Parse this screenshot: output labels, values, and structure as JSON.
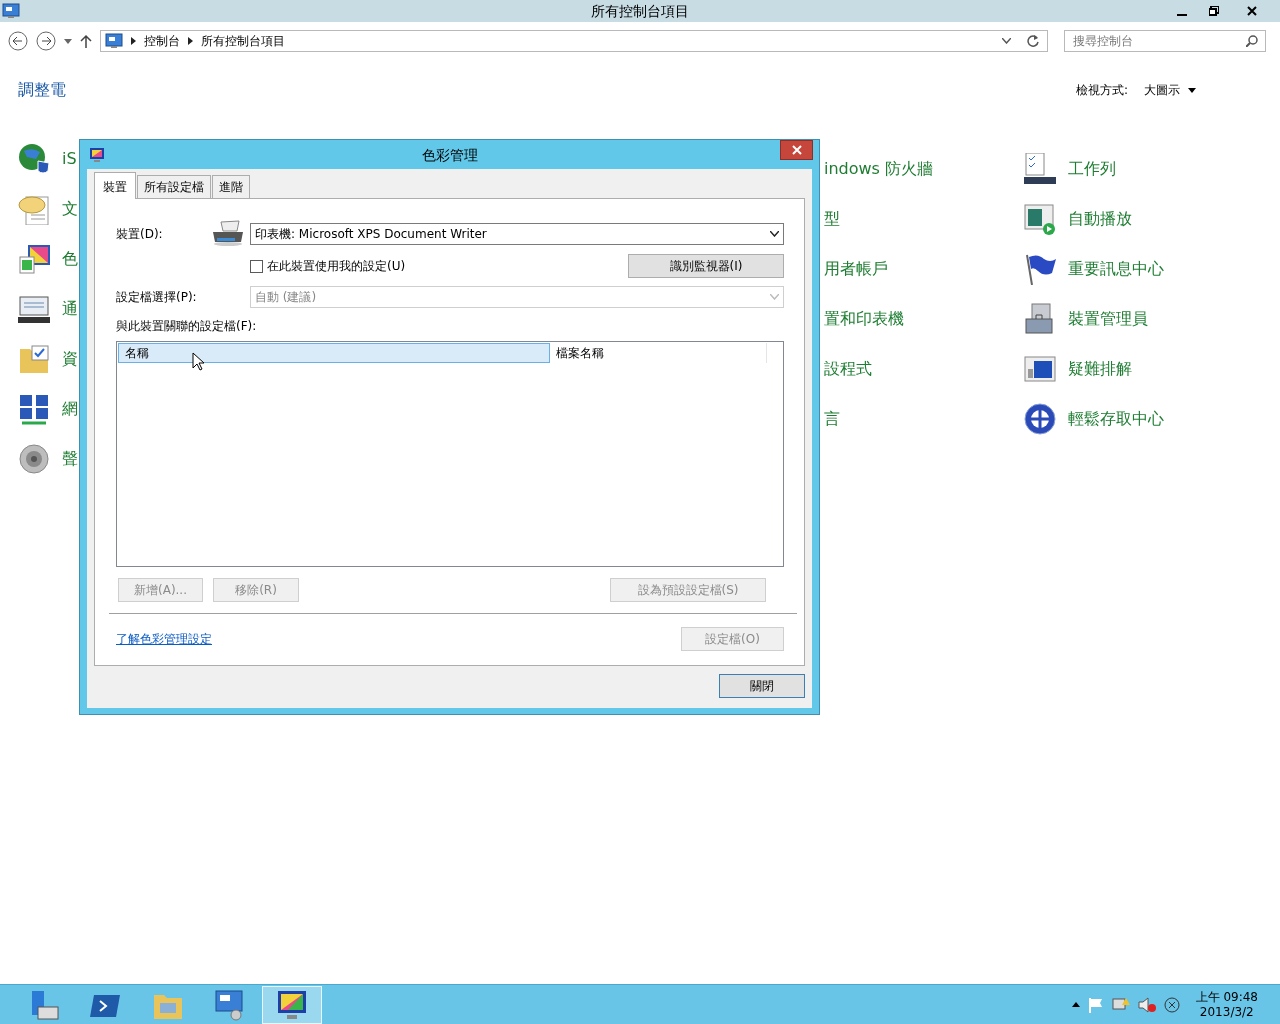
{
  "window": {
    "title": "所有控制台項目"
  },
  "address_bar": {
    "breadcrumbs": [
      "控制台",
      "所有控制台項目"
    ]
  },
  "search": {
    "placeholder": "搜尋控制台"
  },
  "heading": "調整電",
  "view_by": {
    "label": "檢視方式:",
    "value": "大圖示"
  },
  "items_left": [
    {
      "kind": "globe",
      "label": "iS"
    },
    {
      "kind": "speech",
      "label": "文"
    },
    {
      "kind": "color",
      "label": "色"
    },
    {
      "kind": "display",
      "label": "通"
    },
    {
      "kind": "folder",
      "label": "資"
    },
    {
      "kind": "network",
      "label": "網"
    },
    {
      "kind": "speaker",
      "label": "聲"
    }
  ],
  "items_middle": [
    {
      "label": "indows 防火牆"
    },
    {
      "label": "型"
    },
    {
      "label": "用者帳戶"
    },
    {
      "label": "置和印表機"
    },
    {
      "label": "設程式"
    },
    {
      "label": "言"
    }
  ],
  "items_right": [
    {
      "kind": "checklist",
      "label": "工作列"
    },
    {
      "kind": "autoplay",
      "label": "自動播放"
    },
    {
      "kind": "flag",
      "label": "重要訊息中心"
    },
    {
      "kind": "toolbox",
      "label": "裝置管理員"
    },
    {
      "kind": "monitor",
      "label": "疑難排解"
    },
    {
      "kind": "access",
      "label": "輕鬆存取中心"
    }
  ],
  "dialog": {
    "title": "色彩管理",
    "tabs": [
      {
        "label": "裝置",
        "selected": true
      },
      {
        "label": "所有設定檔",
        "selected": false
      },
      {
        "label": "進階",
        "selected": false
      }
    ],
    "device": {
      "label": "裝置(D):",
      "value": "印表機: Microsoft XPS Document Writer"
    },
    "use_my_settings": {
      "label": "在此裝置使用我的設定(U)",
      "checked": false
    },
    "identify_button": {
      "label": "識別監視器(I)",
      "disabled": false
    },
    "profile_selection": {
      "label": "設定檔選擇(P):",
      "value": "自動 (建議)",
      "disabled": true
    },
    "profiles_label": "與此裝置關聯的設定檔(F):",
    "columns": [
      {
        "label": "名稱",
        "selected": true
      },
      {
        "label": "檔案名稱",
        "selected": false
      }
    ],
    "list_buttons": [
      {
        "label": "新增(A)...",
        "disabled": true
      },
      {
        "label": "移除(R)",
        "disabled": true
      },
      {
        "label": "設為預設設定檔(S)",
        "disabled": true
      }
    ],
    "link": "了解色彩管理設定",
    "profiles_button": {
      "label": "設定檔(O)",
      "disabled": true
    },
    "close_button": "關閉"
  },
  "taskbar": {
    "apps": [
      {
        "kind": "server",
        "selected": false
      },
      {
        "kind": "terminal",
        "selected": false
      },
      {
        "kind": "explorer",
        "selected": false
      },
      {
        "kind": "control-panel",
        "selected": false
      },
      {
        "kind": "color",
        "selected": true
      }
    ],
    "clock": {
      "time": "上午 09:48",
      "date": "2013/3/2"
    }
  }
}
